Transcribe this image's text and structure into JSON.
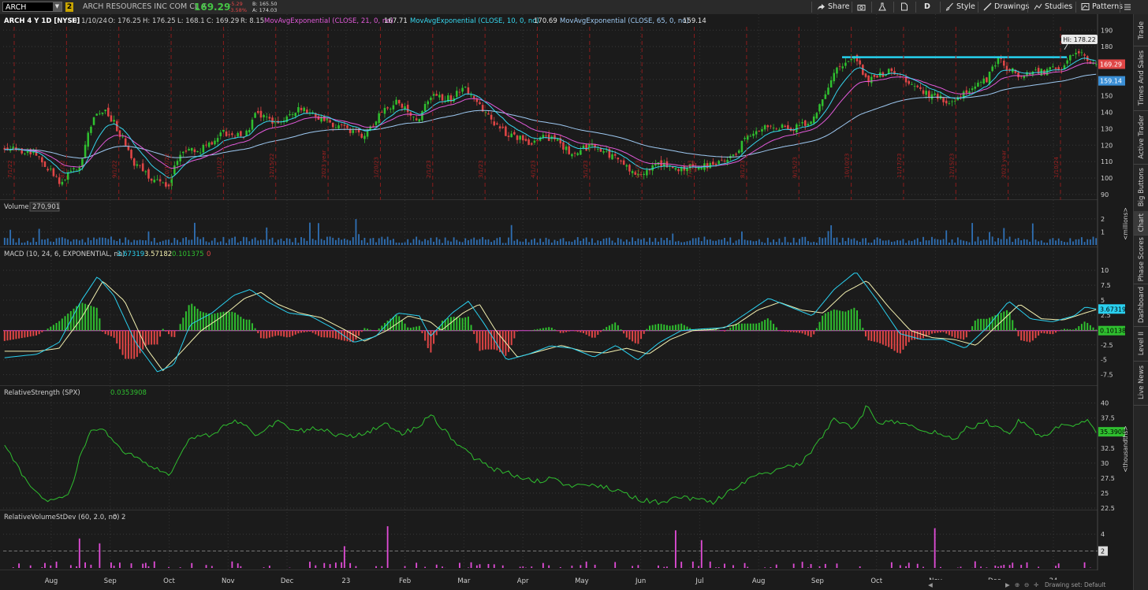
{
  "toolbar": {
    "symbol": "ARCH",
    "link_badge": "2",
    "company": "ARCH RESOURCES INC COM CL A",
    "last": "169.29",
    "change": "-5.29",
    "change_pct": "-3.58%",
    "bid": "B: 165.50",
    "ask": "A: 174.03",
    "share": "Share",
    "aggregation": "D",
    "style": "Style",
    "drawings": "Drawings",
    "studies": "Studies",
    "patterns": "Patterns"
  },
  "side_tabs": [
    "Trade",
    "Times And Sales",
    "Active Trader",
    "Big Buttons",
    "Chart",
    "Phase Scores",
    "Dashboard",
    "Level II",
    "Live News"
  ],
  "status_text": "Drawing set: Default",
  "colors": {
    "up": "#2fbf2f",
    "down": "#e04646",
    "ema21": "#e15ad9",
    "ema10": "#36d7ef",
    "ema65": "#9ec9f2",
    "trendline": "#26d2f0",
    "macd_line": "#2ad1f0",
    "signal_line": "#f3f0b0",
    "rs_line": "#2fbf2f",
    "rvsd": "#e04cd6"
  },
  "chart_data": [
    {
      "type": "candlestick",
      "header": {
        "title": "ARCH 4 Y 1D [NYSE]",
        "date": "D: 1/10/24",
        "open": "O: 176.25",
        "high": "H: 176.25",
        "low": "L: 168.1",
        "close": "C: 169.29",
        "range": "R: 8.15"
      },
      "studies": [
        {
          "label": "MovAvgExponential (CLOSE, 21, 0, no)",
          "value": "167.71",
          "color": "#e15ad9"
        },
        {
          "label": "MovAvgExponential (CLOSE, 10, 0, no)",
          "value": "170.69",
          "color": "#36d7ef"
        },
        {
          "label": "MovAvgExponential (CLOSE, 65, 0, no)",
          "value": "159.14",
          "color": "#9ec9f2"
        }
      ],
      "ylim": [
        88,
        193
      ],
      "yticks": [
        90,
        100,
        110,
        120,
        130,
        140,
        150,
        160,
        170,
        180,
        190
      ],
      "price_path": [
        [
          0,
          118
        ],
        [
          0.03,
          114
        ],
        [
          0.05,
          98
        ],
        [
          0.07,
          108
        ],
        [
          0.08,
          135
        ],
        [
          0.09,
          142
        ],
        [
          0.1,
          134
        ],
        [
          0.12,
          108
        ],
        [
          0.14,
          97
        ],
        [
          0.15,
          95
        ],
        [
          0.16,
          115
        ],
        [
          0.18,
          117
        ],
        [
          0.2,
          128
        ],
        [
          0.22,
          126
        ],
        [
          0.23,
          138
        ],
        [
          0.25,
          133
        ],
        [
          0.27,
          142
        ],
        [
          0.29,
          136
        ],
        [
          0.31,
          130
        ],
        [
          0.33,
          126
        ],
        [
          0.345,
          140
        ],
        [
          0.36,
          146
        ],
        [
          0.38,
          135
        ],
        [
          0.39,
          150
        ],
        [
          0.41,
          148
        ],
        [
          0.42,
          157
        ],
        [
          0.44,
          140
        ],
        [
          0.46,
          126
        ],
        [
          0.48,
          122
        ],
        [
          0.5,
          125
        ],
        [
          0.52,
          115
        ],
        [
          0.54,
          120
        ],
        [
          0.56,
          112
        ],
        [
          0.58,
          102
        ],
        [
          0.6,
          108
        ],
        [
          0.62,
          106
        ],
        [
          0.64,
          108
        ],
        [
          0.65,
          108
        ],
        [
          0.665,
          112
        ],
        [
          0.68,
          124
        ],
        [
          0.7,
          132
        ],
        [
          0.72,
          130
        ],
        [
          0.74,
          135
        ],
        [
          0.75,
          150
        ],
        [
          0.76,
          165
        ],
        [
          0.78,
          174
        ],
        [
          0.79,
          158
        ],
        [
          0.81,
          165
        ],
        [
          0.83,
          156
        ],
        [
          0.85,
          150
        ],
        [
          0.87,
          145
        ],
        [
          0.88,
          152
        ],
        [
          0.9,
          160
        ],
        [
          0.91,
          172
        ],
        [
          0.93,
          162
        ],
        [
          0.95,
          165
        ],
        [
          0.97,
          168
        ],
        [
          0.98,
          178
        ],
        [
          1.0,
          169.29
        ]
      ],
      "ema10_value": 170.69,
      "ema21_value": 167.71,
      "ema65_value": 159.14,
      "last_close": 169.29,
      "hi_label": "Hi: 178.22",
      "trendline_price": 173.5,
      "date_markers": [
        "7/1/22",
        "8/1/22",
        "9/1/22",
        "10/17/22",
        "11/1/22",
        "12/15/22",
        "2023 year",
        "1/20/23",
        "2/1/23",
        "3/1/23",
        "4/1/23",
        "5/1/23",
        "6/1/23",
        "7/3/23",
        "8/1/23",
        "9/15/23",
        "10/10/23",
        "11/17/23",
        "12/15/23",
        "2023 year",
        "1/10/24"
      ]
    },
    {
      "type": "bar",
      "label": "Volume",
      "value": "270,901",
      "ylabel": "<millions>",
      "ylim": [
        0,
        2.6
      ],
      "yticks": [
        1,
        2
      ]
    },
    {
      "type": "bar+line",
      "label": "MACD (10, 24, 6, EXPONENTIAL, no)",
      "values": [
        "3.67319",
        "3.57182",
        "0.101375",
        "0"
      ],
      "value_colors": [
        "#2ad1f0",
        "#f3f0b0",
        "#2fbf2f",
        "#e04646"
      ],
      "ylim": [
        -9,
        12
      ],
      "yticks": [
        -7.5,
        -5,
        -2.5,
        2.5,
        5,
        7.5,
        10
      ],
      "macd_path": [
        [
          0,
          -4.6
        ],
        [
          0.03,
          -4
        ],
        [
          0.05,
          -2
        ],
        [
          0.07,
          5
        ],
        [
          0.085,
          9.2
        ],
        [
          0.1,
          6
        ],
        [
          0.12,
          -2
        ],
        [
          0.14,
          -7
        ],
        [
          0.155,
          -5.8
        ],
        [
          0.17,
          1
        ],
        [
          0.19,
          3
        ],
        [
          0.21,
          6
        ],
        [
          0.225,
          7
        ],
        [
          0.24,
          5
        ],
        [
          0.26,
          3
        ],
        [
          0.28,
          2.5
        ],
        [
          0.3,
          0.5
        ],
        [
          0.32,
          -2
        ],
        [
          0.34,
          -1
        ],
        [
          0.36,
          3
        ],
        [
          0.38,
          2.5
        ],
        [
          0.39,
          -1
        ],
        [
          0.41,
          3
        ],
        [
          0.425,
          5
        ],
        [
          0.44,
          1
        ],
        [
          0.46,
          -5
        ],
        [
          0.48,
          -4
        ],
        [
          0.5,
          -2.6
        ],
        [
          0.52,
          -3
        ],
        [
          0.54,
          -4.5
        ],
        [
          0.56,
          -2.5
        ],
        [
          0.58,
          -5
        ],
        [
          0.6,
          -2
        ],
        [
          0.62,
          0
        ],
        [
          0.64,
          0.3
        ],
        [
          0.66,
          0.5
        ],
        [
          0.68,
          3
        ],
        [
          0.7,
          5.5
        ],
        [
          0.72,
          4
        ],
        [
          0.74,
          2.5
        ],
        [
          0.76,
          7
        ],
        [
          0.78,
          10
        ],
        [
          0.8,
          5
        ],
        [
          0.82,
          -0.5
        ],
        [
          0.84,
          -1.5
        ],
        [
          0.86,
          -1.5
        ],
        [
          0.88,
          -3
        ],
        [
          0.9,
          0.5
        ],
        [
          0.92,
          5
        ],
        [
          0.94,
          2
        ],
        [
          0.96,
          1.5
        ],
        [
          0.98,
          2.5
        ],
        [
          0.99,
          4
        ],
        [
          1.0,
          3.67
        ]
      ],
      "signal_path": [
        [
          0,
          -3.5
        ],
        [
          0.03,
          -3.5
        ],
        [
          0.05,
          -3
        ],
        [
          0.07,
          2
        ],
        [
          0.09,
          8.4
        ],
        [
          0.11,
          5
        ],
        [
          0.13,
          -3
        ],
        [
          0.145,
          -6.8
        ],
        [
          0.16,
          -4
        ],
        [
          0.18,
          0
        ],
        [
          0.2,
          2.5
        ],
        [
          0.22,
          5.5
        ],
        [
          0.235,
          6.5
        ],
        [
          0.25,
          4.5
        ],
        [
          0.27,
          3
        ],
        [
          0.29,
          2.2
        ],
        [
          0.31,
          0.3
        ],
        [
          0.33,
          -1.8
        ],
        [
          0.35,
          0
        ],
        [
          0.37,
          2.5
        ],
        [
          0.39,
          1.5
        ],
        [
          0.4,
          0
        ],
        [
          0.42,
          3
        ],
        [
          0.435,
          4.5
        ],
        [
          0.45,
          0
        ],
        [
          0.47,
          -4.5
        ],
        [
          0.49,
          -3.5
        ],
        [
          0.51,
          -2.5
        ],
        [
          0.53,
          -3.5
        ],
        [
          0.55,
          -3.8
        ],
        [
          0.57,
          -3
        ],
        [
          0.59,
          -4
        ],
        [
          0.61,
          -1.5
        ],
        [
          0.63,
          0
        ],
        [
          0.65,
          0.2
        ],
        [
          0.67,
          1
        ],
        [
          0.69,
          3.5
        ],
        [
          0.71,
          4.8
        ],
        [
          0.73,
          3.5
        ],
        [
          0.75,
          3
        ],
        [
          0.77,
          6.5
        ],
        [
          0.79,
          8.5
        ],
        [
          0.81,
          4
        ],
        [
          0.83,
          0
        ],
        [
          0.85,
          -1.2
        ],
        [
          0.87,
          -1.5
        ],
        [
          0.89,
          -2.5
        ],
        [
          0.91,
          1
        ],
        [
          0.93,
          4.5
        ],
        [
          0.95,
          2
        ],
        [
          0.97,
          1.8
        ],
        [
          0.99,
          3
        ],
        [
          1.0,
          3.57
        ]
      ],
      "macd_tag": "3.67319",
      "hist_tag": "0.10138"
    },
    {
      "type": "line",
      "label": "RelativeStrength (SPX)",
      "value": "0.0353908",
      "ylabel": "<thousandths>",
      "ylim": [
        22.5,
        41
      ],
      "yticks": [
        22.5,
        25,
        27.5,
        30,
        32.5,
        35,
        37.5,
        40
      ],
      "path": [
        [
          0,
          33
        ],
        [
          0.02,
          27
        ],
        [
          0.04,
          23.5
        ],
        [
          0.06,
          25
        ],
        [
          0.07,
          32
        ],
        [
          0.08,
          35.5
        ],
        [
          0.09,
          36
        ],
        [
          0.11,
          32
        ],
        [
          0.13,
          30
        ],
        [
          0.15,
          28
        ],
        [
          0.16,
          31
        ],
        [
          0.17,
          34.5
        ],
        [
          0.19,
          35
        ],
        [
          0.21,
          37.5
        ],
        [
          0.23,
          35
        ],
        [
          0.25,
          37
        ],
        [
          0.27,
          35.5
        ],
        [
          0.29,
          36
        ],
        [
          0.31,
          34.5
        ],
        [
          0.33,
          35
        ],
        [
          0.35,
          37
        ],
        [
          0.36,
          35
        ],
        [
          0.38,
          36
        ],
        [
          0.39,
          38.5
        ],
        [
          0.41,
          34
        ],
        [
          0.43,
          31
        ],
        [
          0.45,
          29
        ],
        [
          0.47,
          28
        ],
        [
          0.49,
          27
        ],
        [
          0.5,
          27.5
        ],
        [
          0.52,
          26
        ],
        [
          0.54,
          26.5
        ],
        [
          0.56,
          25.5
        ],
        [
          0.58,
          24
        ],
        [
          0.6,
          23.5
        ],
        [
          0.62,
          24.5
        ],
        [
          0.63,
          24
        ],
        [
          0.65,
          23.5
        ],
        [
          0.67,
          26
        ],
        [
          0.69,
          28
        ],
        [
          0.71,
          29
        ],
        [
          0.73,
          30
        ],
        [
          0.75,
          35
        ],
        [
          0.76,
          37.5
        ],
        [
          0.78,
          36
        ],
        [
          0.79,
          40
        ],
        [
          0.8,
          37
        ],
        [
          0.82,
          37
        ],
        [
          0.84,
          35.5
        ],
        [
          0.86,
          35
        ],
        [
          0.87,
          34
        ],
        [
          0.88,
          36
        ],
        [
          0.9,
          37
        ],
        [
          0.92,
          35
        ],
        [
          0.93,
          37.5
        ],
        [
          0.95,
          34.5
        ],
        [
          0.97,
          37
        ],
        [
          0.98,
          36.5
        ],
        [
          0.99,
          37.5
        ],
        [
          1.0,
          35.39
        ]
      ],
      "tag": "35.3908"
    },
    {
      "type": "bar",
      "label": "RelativeVolumeStDev (60, 2.0, no)",
      "values": [
        "0",
        "2"
      ],
      "ylim": [
        0,
        5.5
      ],
      "yticks": [
        2,
        4
      ],
      "tag": "2"
    }
  ],
  "x_axis": [
    "Aug",
    "Sep",
    "Oct",
    "Nov",
    "Dec",
    "23",
    "Feb",
    "Mar",
    "Apr",
    "May",
    "Jun",
    "Jul",
    "Aug",
    "Sep",
    "Oct",
    "Nov",
    "Dec",
    "24"
  ]
}
